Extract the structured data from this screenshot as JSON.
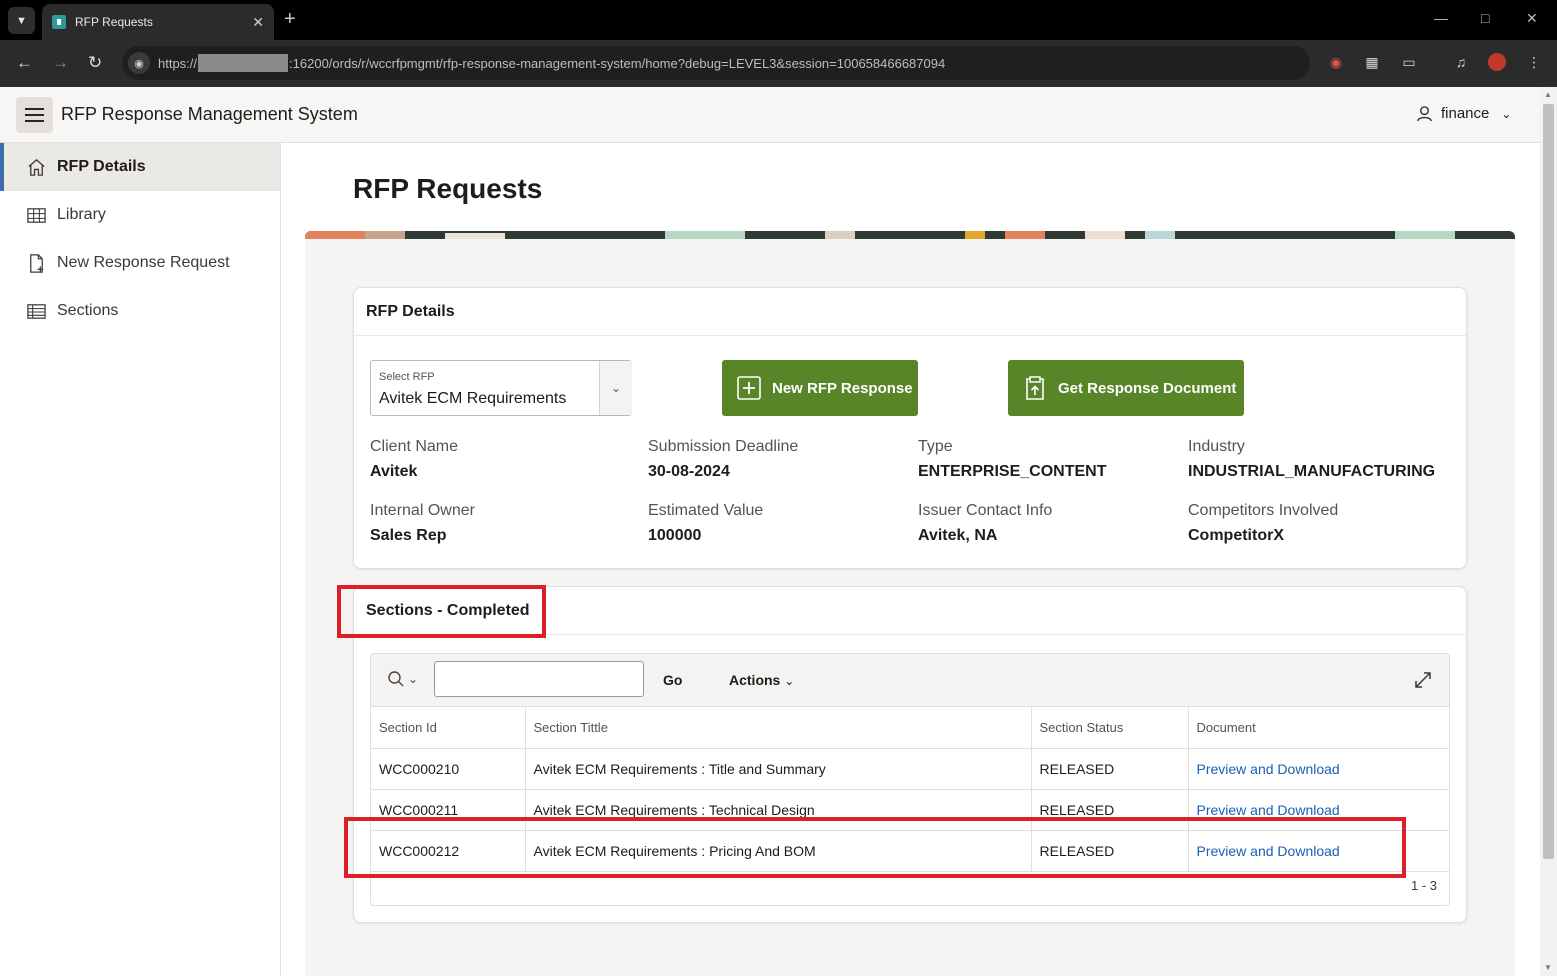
{
  "browser": {
    "tab_title": "RFP Requests",
    "url_prefix": "https://",
    "url_suffix": ":16200/ords/r/wccrfpmgmt/rfp-response-management-system/home?debug=LEVEL3&session=100658466687094"
  },
  "app": {
    "title": "RFP Response Management System",
    "user": "finance"
  },
  "sidebar": {
    "items": [
      {
        "label": "RFP Details",
        "icon": "home-icon",
        "active": true
      },
      {
        "label": "Library",
        "icon": "grid-icon",
        "active": false
      },
      {
        "label": "New Response Request",
        "icon": "file-plus-icon",
        "active": false
      },
      {
        "label": "Sections",
        "icon": "table-icon",
        "active": false
      }
    ]
  },
  "page": {
    "title": "RFP Requests"
  },
  "rfp_details": {
    "heading": "RFP Details",
    "select_label": "Select RFP",
    "select_value": "Avitek ECM Requirements",
    "new_button": "New RFP Response",
    "get_doc_button": "Get Response Document",
    "fields": {
      "client_name": {
        "label": "Client Name",
        "value": "Avitek"
      },
      "deadline": {
        "label": "Submission Deadline",
        "value": "30-08-2024"
      },
      "type": {
        "label": "Type",
        "value": "ENTERPRISE_CONTENT"
      },
      "industry": {
        "label": "Industry",
        "value": "INDUSTRIAL_MANUFACTURING"
      },
      "owner": {
        "label": "Internal Owner",
        "value": "Sales Rep"
      },
      "est_value": {
        "label": "Estimated Value",
        "value": "100000"
      },
      "issuer": {
        "label": "Issuer Contact Info",
        "value": "Avitek, NA"
      },
      "competitors": {
        "label": "Competitors Involved",
        "value": "CompetitorX"
      }
    }
  },
  "sections": {
    "heading": "Sections - Completed",
    "search_placeholder": "",
    "go_label": "Go",
    "actions_label": "Actions",
    "columns": [
      "Section Id",
      "Section Tittle",
      "Section Status",
      "Document"
    ],
    "rows": [
      {
        "id": "WCC000210",
        "title": "Avitek ECM Requirements : Title and Summary",
        "status": "RELEASED",
        "doc": "Preview and Download"
      },
      {
        "id": "WCC000211",
        "title": "Avitek ECM Requirements : Technical Design",
        "status": "RELEASED",
        "doc": "Preview and Download"
      },
      {
        "id": "WCC000212",
        "title": "Avitek ECM Requirements : Pricing And BOM",
        "status": "RELEASED",
        "doc": "Preview and Download"
      }
    ],
    "pagination": "1 - 3"
  },
  "colors": {
    "accent_green": "#588527",
    "highlight_red": "#dd2027",
    "link_blue": "#1a5fb4"
  }
}
